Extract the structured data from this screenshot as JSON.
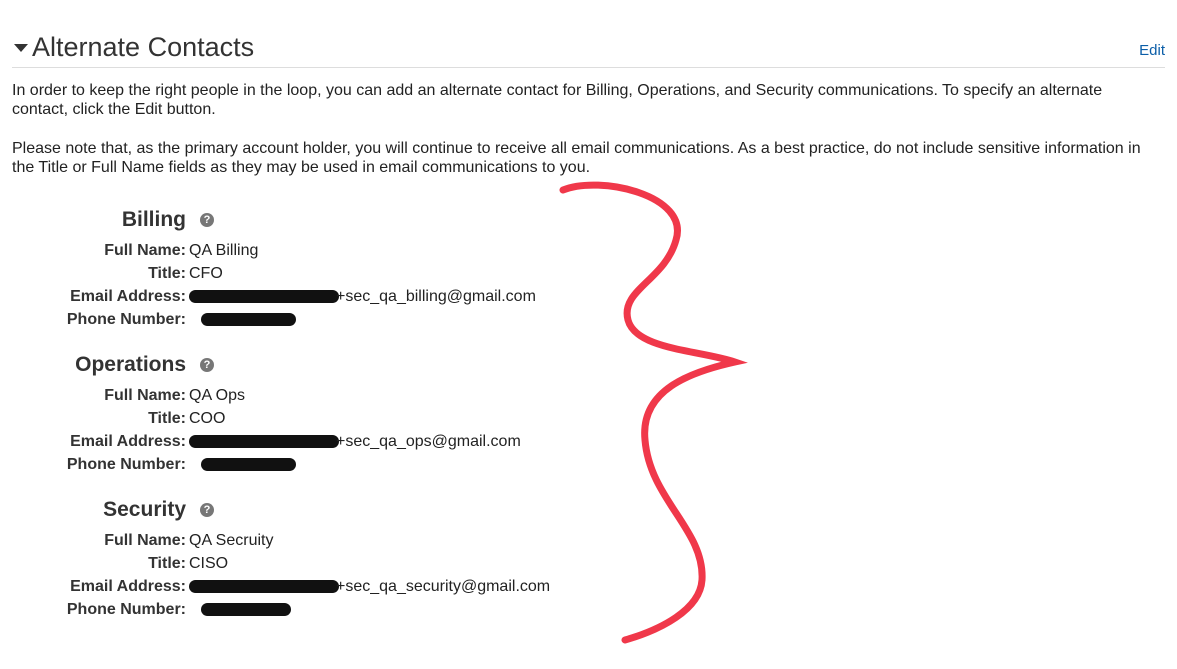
{
  "header": {
    "title": "Alternate Contacts",
    "edit_label": "Edit"
  },
  "intro": [
    "In order to keep the right people in the loop, you can add an alternate contact for Billing, Operations, and Security communications. To specify an alternate contact, click the Edit button.",
    "Please note that, as the primary account holder, you will continue to receive all email communications. As a best practice, do not include sensitive information in the Title or Full Name fields as they may be used in email communications to you."
  ],
  "labels": {
    "full_name": "Full Name:",
    "title": "Title:",
    "email": "Email Address:",
    "phone": "Phone Number:"
  },
  "sections": [
    {
      "heading": "Billing",
      "full_name": "QA Billing",
      "title": "CFO",
      "email_visible": "+sec_qa_billing@gmail.com"
    },
    {
      "heading": "Operations",
      "full_name": "QA Ops",
      "title": "COO",
      "email_visible": "+sec_qa_ops@gmail.com"
    },
    {
      "heading": "Security",
      "full_name": "QA Secruity",
      "title": "CISO",
      "email_visible": "+sec_qa_security@gmail.com"
    }
  ],
  "icons": {
    "help": "question-circle-icon",
    "collapse": "caret-down-icon"
  },
  "colors": {
    "link": "#0b5ea8",
    "annotation": "#f0384a"
  }
}
